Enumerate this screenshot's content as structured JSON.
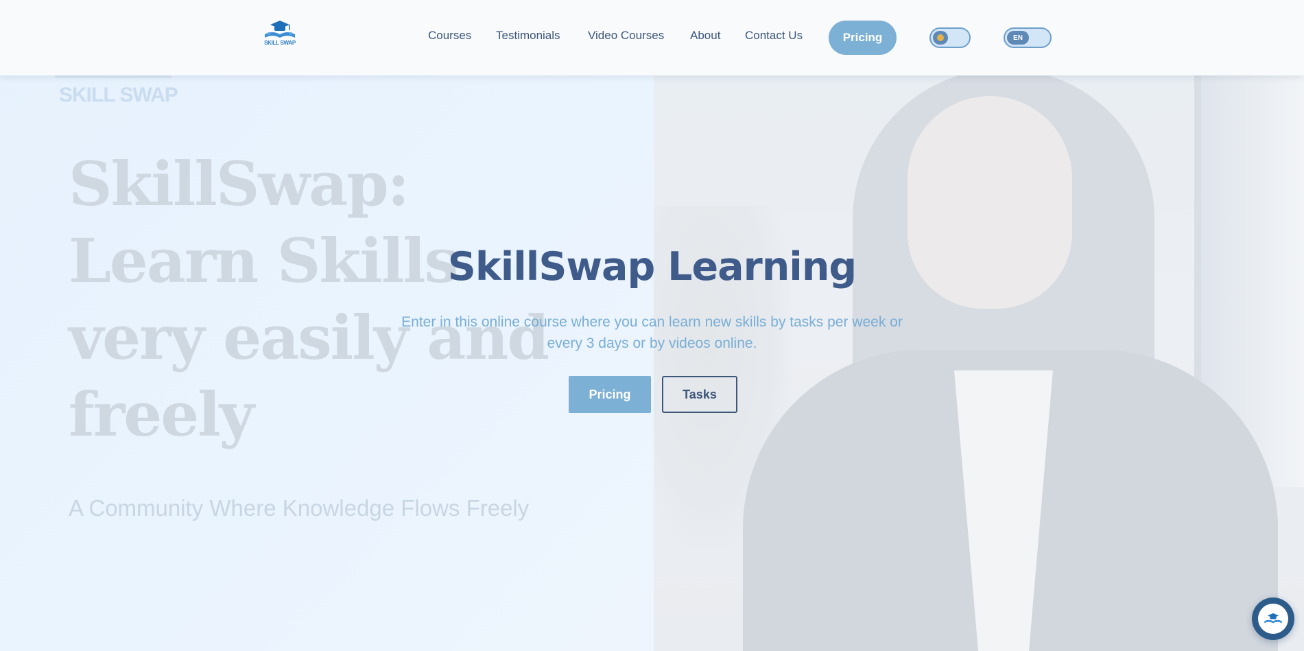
{
  "header": {
    "logo_text": "SKILL SWAP",
    "nav": [
      {
        "label": "Courses"
      },
      {
        "label": "Testimonials"
      },
      {
        "label": "Video Courses"
      },
      {
        "label": "About"
      },
      {
        "label": "Contact Us"
      }
    ],
    "pricing_label": "Pricing",
    "theme_toggle": {
      "icon": "sun-icon",
      "state": "light"
    },
    "language_toggle": {
      "label": "EN"
    }
  },
  "background": {
    "logo_text": "SKILL SWAP",
    "headline": "SkillSwap: Learn Skills very easily and freely",
    "tagline": "A Community Where Knowledge Flows Freely"
  },
  "hero": {
    "title": "SkillSwap Learning",
    "subtitle": "Enter in this online course where you can learn new skills by tasks per week or every 3 days or by videos online.",
    "primary_button": "Pricing",
    "secondary_button": "Tasks"
  },
  "chat": {
    "icon": "skillswap-logo-icon"
  },
  "colors": {
    "accent": "#7cb0d4",
    "navy": "#3d5679",
    "title": "#3f5b89",
    "subtitle": "#79aed5"
  }
}
